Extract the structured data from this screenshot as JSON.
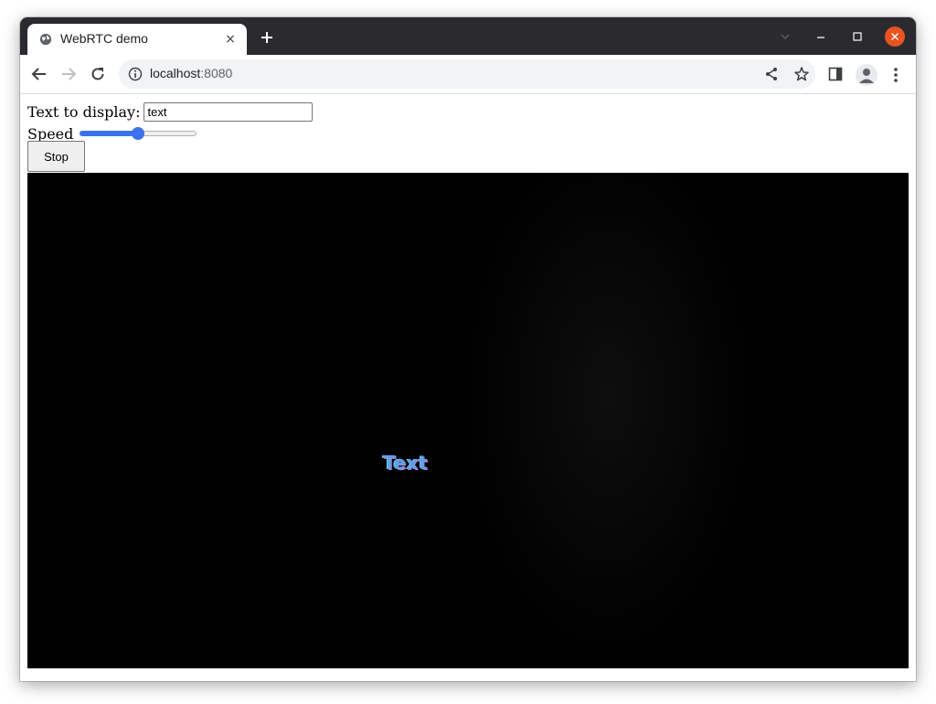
{
  "browser": {
    "tab": {
      "title": "WebRTC demo",
      "close_glyph": "×",
      "icon": "globe-icon"
    },
    "new_tab_glyph": "+",
    "address": {
      "host": "localhost",
      "port": ":8080"
    },
    "window_controls": [
      "minimize",
      "maximize",
      "close"
    ],
    "accent_close": "#e95420"
  },
  "form": {
    "text_label": "Text to display:",
    "text_value": "text",
    "speed_label": "Speed",
    "speed_value": 0.5,
    "stop_label": "Stop"
  },
  "video": {
    "overlay_text": "Text"
  },
  "colors": {
    "slider_accent": "#3b72ec",
    "video_text": "#5aa4e6"
  }
}
